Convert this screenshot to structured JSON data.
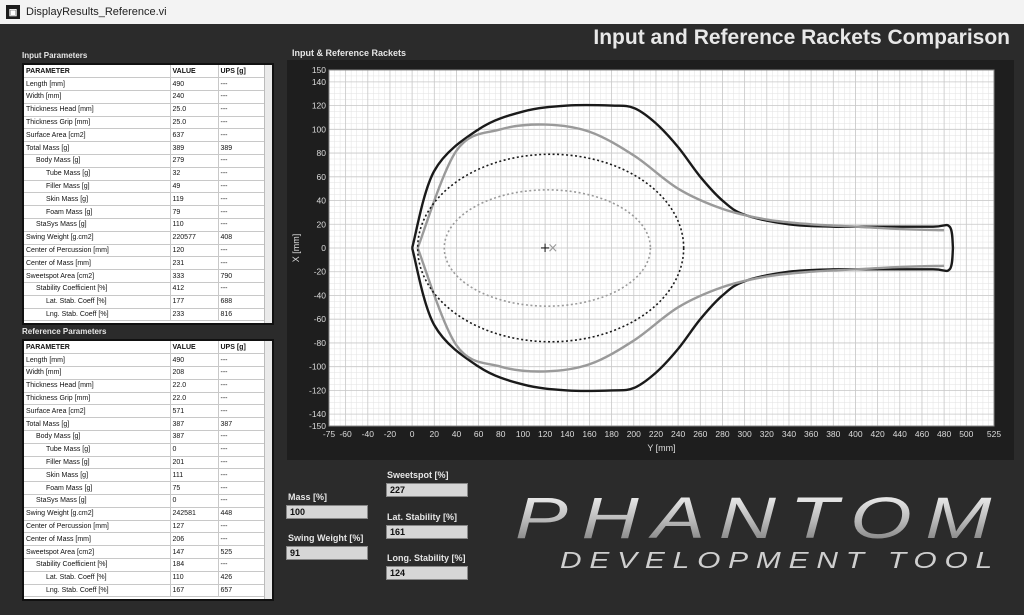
{
  "window": {
    "title": "DisplayResults_Reference.vi",
    "icon": "app-logo-icon"
  },
  "page": {
    "title": "Input and Reference Rackets Comparison"
  },
  "input_params": {
    "label": "Input Parameters",
    "headers": [
      "PARAMETER",
      "VALUE",
      "UPS [g]"
    ],
    "rows": [
      {
        "name": "Length [mm]",
        "value": "490",
        "ups": "---",
        "indent": 0
      },
      {
        "name": "Width [mm]",
        "value": "240",
        "ups": "---",
        "indent": 0
      },
      {
        "name": "Thickness Head [mm]",
        "value": "25.0",
        "ups": "---",
        "indent": 0
      },
      {
        "name": "Thickness Grip [mm]",
        "value": "25.0",
        "ups": "---",
        "indent": 0
      },
      {
        "name": "Surface Area [cm2]",
        "value": "637",
        "ups": "---",
        "indent": 0
      },
      {
        "name": "Total Mass [g]",
        "value": "389",
        "ups": "389",
        "indent": 0
      },
      {
        "name": "Body Mass [g]",
        "value": "279",
        "ups": "---",
        "indent": 1
      },
      {
        "name": "Tube Mass [g]",
        "value": "32",
        "ups": "---",
        "indent": 2
      },
      {
        "name": "Filler Mass [g]",
        "value": "49",
        "ups": "---",
        "indent": 2
      },
      {
        "name": "Skin Mass [g]",
        "value": "119",
        "ups": "---",
        "indent": 2
      },
      {
        "name": "Foam Mass [g]",
        "value": "79",
        "ups": "---",
        "indent": 2
      },
      {
        "name": "StaSys Mass [g]",
        "value": "110",
        "ups": "---",
        "indent": 1
      },
      {
        "name": "Swing Weight [g.cm2]",
        "value": "220577",
        "ups": "408",
        "indent": 0
      },
      {
        "name": "Center of Percussion [mm]",
        "value": "120",
        "ups": "---",
        "indent": 0
      },
      {
        "name": "Center of Mass [mm]",
        "value": "231",
        "ups": "---",
        "indent": 0
      },
      {
        "name": "Sweetspot Area [cm2]",
        "value": "333",
        "ups": "790",
        "indent": 0
      },
      {
        "name": "Stability Coefficient [%]",
        "value": "412",
        "ups": "---",
        "indent": 1
      },
      {
        "name": "Lat. Stab. Coeff [%]",
        "value": "177",
        "ups": "688",
        "indent": 2
      },
      {
        "name": "Lng. Stab. Coeff [%]",
        "value": "233",
        "ups": "816",
        "indent": 2
      }
    ]
  },
  "reference_params": {
    "label": "Reference Parameters",
    "headers": [
      "PARAMETER",
      "VALUE",
      "UPS [g]"
    ],
    "rows": [
      {
        "name": "Length [mm]",
        "value": "490",
        "ups": "---",
        "indent": 0
      },
      {
        "name": "Width [mm]",
        "value": "208",
        "ups": "---",
        "indent": 0
      },
      {
        "name": "Thickness Head [mm]",
        "value": "22.0",
        "ups": "---",
        "indent": 0
      },
      {
        "name": "Thickness Grip [mm]",
        "value": "22.0",
        "ups": "---",
        "indent": 0
      },
      {
        "name": "Surface Area [cm2]",
        "value": "571",
        "ups": "---",
        "indent": 0
      },
      {
        "name": "Total Mass [g]",
        "value": "387",
        "ups": "387",
        "indent": 0
      },
      {
        "name": "Body Mass [g]",
        "value": "387",
        "ups": "---",
        "indent": 1
      },
      {
        "name": "Tube Mass [g]",
        "value": "0",
        "ups": "---",
        "indent": 2
      },
      {
        "name": "Filler Mass [g]",
        "value": "201",
        "ups": "---",
        "indent": 2
      },
      {
        "name": "Skin Mass [g]",
        "value": "111",
        "ups": "---",
        "indent": 2
      },
      {
        "name": "Foam Mass [g]",
        "value": "75",
        "ups": "---",
        "indent": 2
      },
      {
        "name": "StaSys Mass [g]",
        "value": "0",
        "ups": "---",
        "indent": 1
      },
      {
        "name": "Swing Weight [g.cm2]",
        "value": "242581",
        "ups": "448",
        "indent": 0
      },
      {
        "name": "Center of Percussion [mm]",
        "value": "127",
        "ups": "---",
        "indent": 0
      },
      {
        "name": "Center of Mass [mm]",
        "value": "206",
        "ups": "---",
        "indent": 0
      },
      {
        "name": "Sweetspot Area [cm2]",
        "value": "147",
        "ups": "525",
        "indent": 0
      },
      {
        "name": "Stability Coefficient [%]",
        "value": "184",
        "ups": "---",
        "indent": 1
      },
      {
        "name": "Lat. Stab. Coeff [%]",
        "value": "110",
        "ups": "426",
        "indent": 2
      },
      {
        "name": "Lng. Stab. Coeff [%]",
        "value": "167",
        "ups": "657",
        "indent": 2
      }
    ]
  },
  "indicators": {
    "mass": {
      "label": "Mass [%]",
      "value": "100"
    },
    "swing_weight": {
      "label": "Swing Weight [%]",
      "value": "91"
    },
    "sweetspot": {
      "label": "Sweetspot [%]",
      "value": "227"
    },
    "lat_stability": {
      "label": "Lat. Stability [%]",
      "value": "161"
    },
    "long_stability": {
      "label": "Long. Stability [%]",
      "value": "124"
    }
  },
  "logo": {
    "line1": "PHANTOM",
    "line2": "DEVELOPMENT TOOL"
  },
  "chart_data": {
    "type": "line",
    "title": "Input & Reference Rackets",
    "xlabel": "Y [mm]",
    "ylabel": "X [mm]",
    "xlim": [
      -75,
      525
    ],
    "ylim": [
      -150,
      150
    ],
    "xticks": [
      -75,
      -60,
      -40,
      -20,
      0,
      20,
      40,
      60,
      80,
      100,
      120,
      140,
      160,
      180,
      200,
      220,
      240,
      260,
      280,
      300,
      320,
      340,
      360,
      380,
      400,
      420,
      440,
      460,
      480,
      500,
      525
    ],
    "yticks": [
      150,
      140,
      120,
      100,
      80,
      60,
      40,
      20,
      0,
      -20,
      -40,
      -60,
      -80,
      -100,
      -120,
      -140,
      -150
    ],
    "grid": true,
    "colors": {
      "input": "#1a1a1a",
      "reference": "#9a9a9a",
      "background": "#ffffff",
      "grid": "#c8c8c8"
    },
    "series": [
      {
        "style": "solid",
        "color": "#1a1a1a",
        "outline_y": [
          0,
          20,
          60,
          100,
          140,
          180,
          200,
          220,
          240,
          260,
          280,
          300,
          340,
          380,
          420,
          470,
          485,
          488
        ],
        "outline_x": [
          0,
          65,
          100,
          115,
          120,
          120,
          118,
          105,
          85,
          60,
          40,
          28,
          20,
          18,
          18,
          18,
          18,
          0
        ]
      },
      {
        "style": "solid",
        "color": "#9a9a9a",
        "outline_y": [
          5,
          40,
          80,
          120,
          160,
          200,
          240,
          280,
          320,
          360,
          400,
          440,
          480
        ],
        "outline_x": [
          0,
          82,
          100,
          104,
          98,
          78,
          50,
          33,
          24,
          20,
          18,
          16,
          15
        ]
      },
      {
        "style": "dotted",
        "color": "#1a1a1a",
        "ellipse": {
          "cx": 125,
          "cy": 0,
          "rx": 120,
          "ry": 79
        }
      },
      {
        "style": "dotted",
        "color": "#9a9a9a",
        "ellipse": {
          "cx": 122,
          "cy": 0,
          "rx": 93,
          "ry": 49
        }
      }
    ],
    "markers": [
      {
        "symbol": "+",
        "y": 120,
        "x": 0,
        "color": "#1a1a1a"
      },
      {
        "symbol": "x",
        "y": 127,
        "x": 0,
        "color": "#9a9a9a"
      }
    ]
  }
}
